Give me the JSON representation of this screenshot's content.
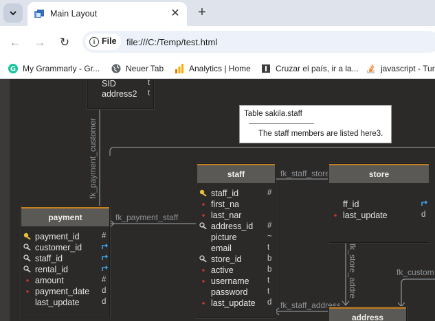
{
  "browser": {
    "tab": {
      "title": "Main Layout"
    },
    "address": {
      "site_label": "File",
      "url": "file:///C:/Temp/test.html"
    },
    "bookmarks": [
      {
        "label": "My Grammarly - Gr...",
        "icon": "grammarly-icon"
      },
      {
        "label": "Neuer Tab",
        "icon": "globe-icon"
      },
      {
        "label": "Analytics | Home",
        "icon": "analytics-icon"
      },
      {
        "label": "Cruzar el país, ir a la...",
        "icon": "bookmark-i-icon"
      },
      {
        "label": "javascript - Tur",
        "icon": "stackoverflow-icon"
      }
    ]
  },
  "diagram": {
    "top_table": {
      "fields": [
        {
          "name": "SID",
          "type": "t"
        },
        {
          "name": "address2",
          "type": "t"
        }
      ]
    },
    "staff": {
      "title": "staff",
      "fields": [
        {
          "name": "staff_id",
          "key": "pk",
          "type": "#"
        },
        {
          "name": "first_na",
          "key": "dot",
          "type": ""
        },
        {
          "name": "last_nar",
          "key": "dot",
          "type": ""
        },
        {
          "name": "address_id",
          "key": "fk",
          "type": "#"
        },
        {
          "name": "picture",
          "key": "none",
          "type": "~"
        },
        {
          "name": "email",
          "key": "none",
          "type": "t"
        },
        {
          "name": "store_id",
          "key": "fk",
          "type": "b"
        },
        {
          "name": "active",
          "key": "dot",
          "type": "b"
        },
        {
          "name": "username",
          "key": "dot",
          "type": "t"
        },
        {
          "name": "password",
          "key": "none",
          "type": "t"
        },
        {
          "name": "last_update",
          "key": "dot",
          "type": "d"
        }
      ]
    },
    "payment": {
      "title": "payment",
      "fields": [
        {
          "name": "payment_id",
          "key": "pk",
          "type": "#"
        },
        {
          "name": "customer_id",
          "key": "fk",
          "type": "↱"
        },
        {
          "name": "staff_id",
          "key": "fk",
          "type": "↱"
        },
        {
          "name": "rental_id",
          "key": "fk",
          "type": "↱"
        },
        {
          "name": "amount",
          "key": "dot",
          "type": "#"
        },
        {
          "name": "payment_date",
          "key": "dot",
          "type": "d"
        },
        {
          "name": "last_update",
          "key": "none",
          "type": "d"
        }
      ]
    },
    "store": {
      "title": "store",
      "fields": [
        {
          "name": "ff_id",
          "key": "none",
          "type": "↱"
        },
        {
          "name": "last_update",
          "key": "dot",
          "type": "d"
        }
      ]
    },
    "address": {
      "title": "address"
    },
    "relations": {
      "fk_payment_customer": "fk_payment_customer",
      "fk_payment_staff": "fk_payment_staff",
      "fk_staff_store": "fk_staff_store",
      "fk_staff_address": "fk_staff_address",
      "fk_store_address": "fk_store_addre",
      "fk_custom": "fk_custom"
    },
    "tooltip": {
      "title": "Table sakila.staff",
      "body": "The staff members are listed here3."
    }
  }
}
